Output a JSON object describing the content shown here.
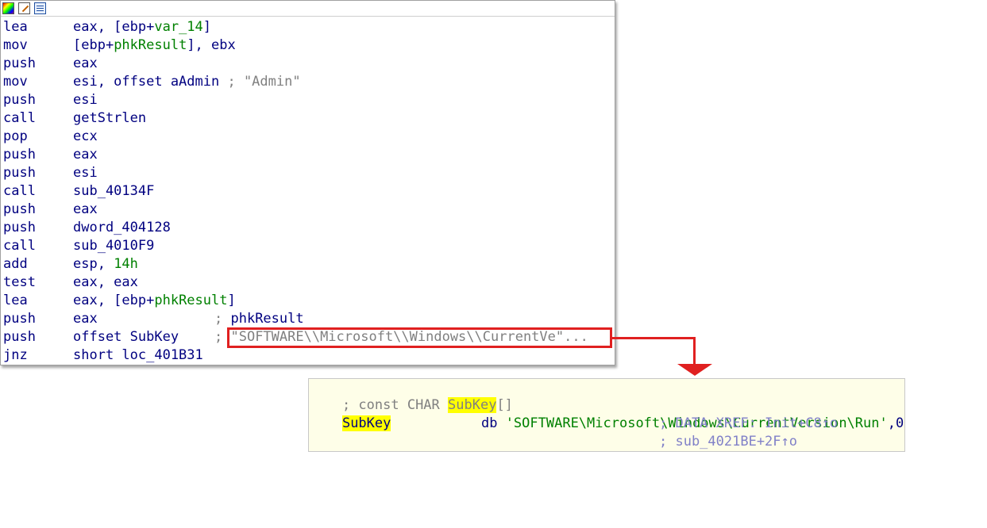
{
  "toolbar": {
    "icons": [
      "graph-view-icon",
      "edit-icon",
      "text-view-icon"
    ]
  },
  "disassembly": [
    {
      "mnemonic": "lea",
      "op1": "eax, [ebp+",
      "op2": "var_14",
      "op3": "]"
    },
    {
      "mnemonic": "mov",
      "op1": "[ebp+",
      "op2": "phkResult",
      "op3": "], ebx"
    },
    {
      "mnemonic": "push",
      "op1": "eax"
    },
    {
      "mnemonic": "mov",
      "op1": "esi, offset aAdmin",
      "comment": "; \"Admin\""
    },
    {
      "mnemonic": "push",
      "op1": "esi"
    },
    {
      "mnemonic": "call",
      "op1": "getStrlen"
    },
    {
      "mnemonic": "pop",
      "op1": "ecx"
    },
    {
      "mnemonic": "push",
      "op1": "eax"
    },
    {
      "mnemonic": "push",
      "op1": "esi"
    },
    {
      "mnemonic": "call",
      "op1": "sub_40134F"
    },
    {
      "mnemonic": "push",
      "op1": "eax"
    },
    {
      "mnemonic": "push",
      "op1": "dword_404128"
    },
    {
      "mnemonic": "call",
      "op1": "sub_4010F9"
    },
    {
      "mnemonic": "add",
      "op1": "esp, ",
      "op2": "14h"
    },
    {
      "mnemonic": "test",
      "op1": "eax, eax"
    },
    {
      "mnemonic": "lea",
      "op1": "eax, [ebp+",
      "op2": "phkResult",
      "op3": "]"
    },
    {
      "mnemonic": "push",
      "op1": "eax",
      "comment_prefix": "; ",
      "comment_name": "phkResult"
    },
    {
      "mnemonic": "push",
      "op1": "offset SubKey",
      "comment_prefix": "; ",
      "comment_string": "\"SOFTWARE\\\\Microsoft\\\\Windows\\\\CurrentVe\"..."
    },
    {
      "mnemonic": "jnz",
      "op1": "short loc_401B31"
    }
  ],
  "data_view": {
    "comment_prefix": "; const CHAR ",
    "comment_name": "SubKey",
    "comment_suffix": "[]",
    "label": "SubKey",
    "directive": "db",
    "string_value": "'SOFTWARE\\Microsoft\\Windows\\CurrentVersion\\Run'",
    "terminator": ",0",
    "xref1": "; DATA XREF: Init+C8↑o",
    "xref2": "; sub_4021BE+2F↑o"
  },
  "colors": {
    "highlight": "#ffff00",
    "annotation_red": "#e02020",
    "data_background": "#fefee8"
  }
}
